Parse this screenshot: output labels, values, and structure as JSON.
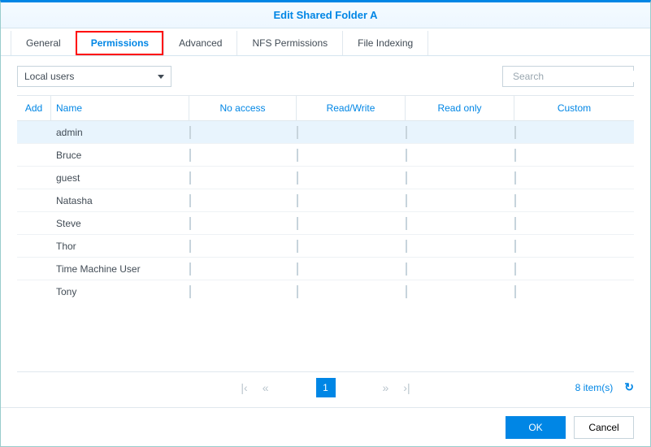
{
  "title": "Edit Shared Folder A",
  "tabs": [
    "General",
    "Permissions",
    "Advanced",
    "NFS Permissions",
    "File Indexing"
  ],
  "active_tab": 1,
  "dropdown": {
    "value": "Local users"
  },
  "search": {
    "placeholder": "Search"
  },
  "columns": {
    "add": "Add",
    "name": "Name",
    "noaccess": "No access",
    "rw": "Read/Write",
    "ro": "Read only",
    "custom": "Custom"
  },
  "rows": [
    {
      "name": "admin",
      "selected": true,
      "ro_disabled": true
    },
    {
      "name": "Bruce"
    },
    {
      "name": "guest"
    },
    {
      "name": "Natasha"
    },
    {
      "name": "Steve"
    },
    {
      "name": "Thor"
    },
    {
      "name": "Time Machine User"
    },
    {
      "name": "Tony"
    }
  ],
  "pager": {
    "page": "1",
    "count": "8 item(s)"
  },
  "buttons": {
    "ok": "OK",
    "cancel": "Cancel"
  }
}
